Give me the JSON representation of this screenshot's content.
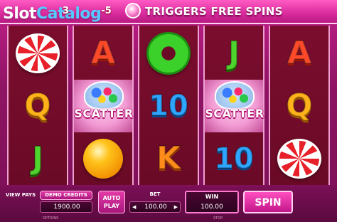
{
  "banner": {
    "logo_part1": "Slot",
    "logo_part2": "Catalog",
    "rule_prefix": "3",
    "rule_range": "-5",
    "rule_scatter_badge": "scatter",
    "rule_text": "TRIGGERS FREE SPINS"
  },
  "reels": [
    [
      "peppermint",
      "Q",
      "J"
    ],
    [
      "A",
      "scatter",
      "drop"
    ],
    [
      "ring",
      "10",
      "K"
    ],
    [
      "J",
      "scatter",
      "10"
    ],
    [
      "A",
      "Q",
      "peppermint"
    ]
  ],
  "symbol_text": {
    "A": "A",
    "Q": "Q",
    "J": "J",
    "K": "K",
    "10": "10",
    "scatter": "SCATTER"
  },
  "controls": {
    "view_pays": "VIEW PAYS",
    "demo_credits_label": "DEMO CREDITS",
    "demo_credits_value": "1900.00",
    "auto_play_line1": "AUTO",
    "auto_play_line2": "PLAY",
    "bet_label": "BET",
    "bet_value": "100.00",
    "win_label": "WIN",
    "win_value": "100.00",
    "spin_label": "SPIN",
    "options": "OPTIONS",
    "stop": "STOP"
  },
  "colors": {
    "accent": "#d92a9c",
    "reel_bg": "#7b0d2e"
  }
}
